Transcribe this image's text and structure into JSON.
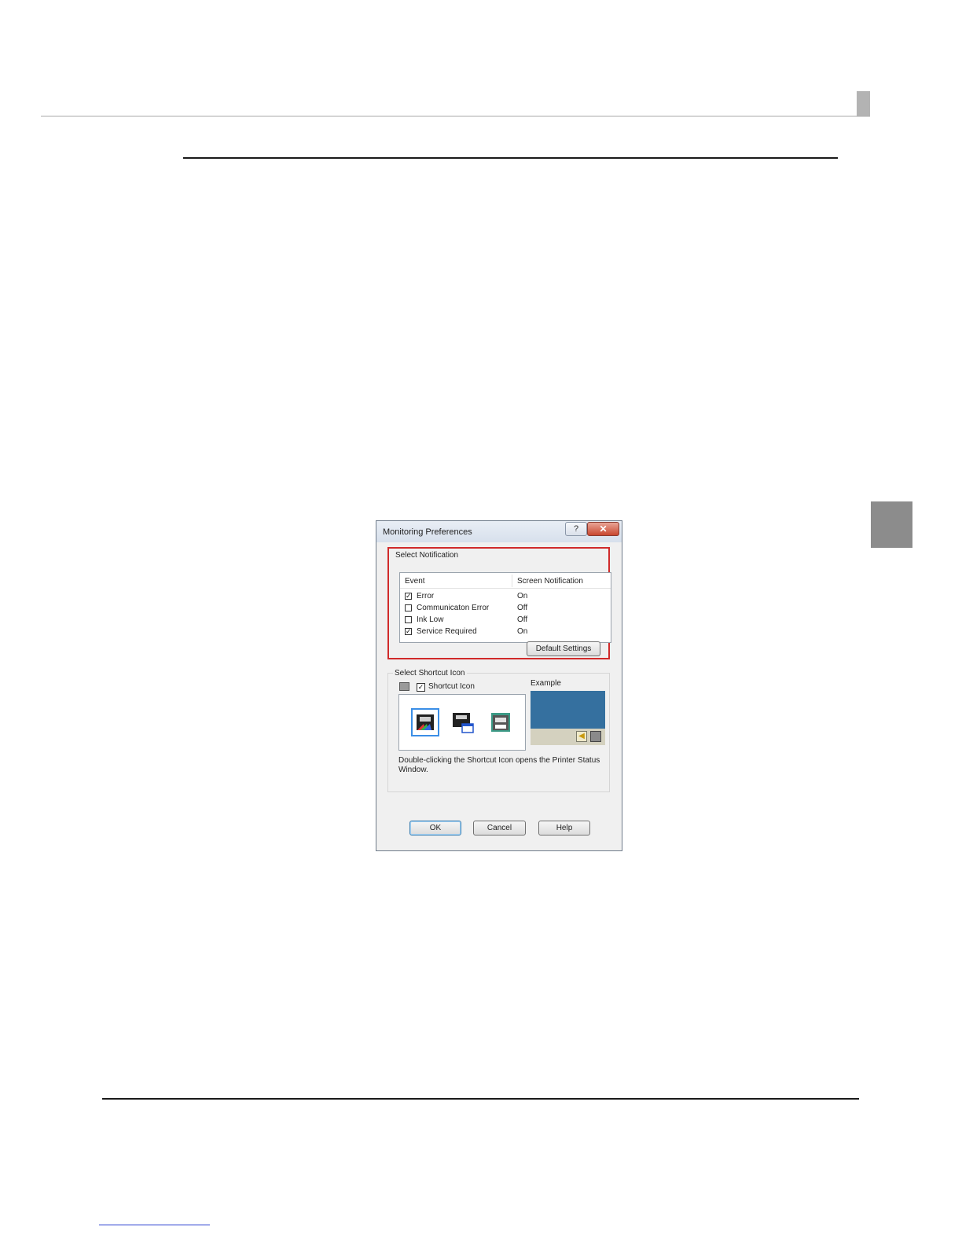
{
  "dialog": {
    "title": "Monitoring Preferences",
    "help_icon": "?",
    "close_icon": "✕",
    "select_notification": {
      "label": "Select Notification",
      "columns": [
        "Event",
        "Screen Notification"
      ],
      "rows": [
        {
          "event": "Error",
          "checked": true,
          "value": "On"
        },
        {
          "event": "Communicaton Error",
          "checked": false,
          "value": "Off"
        },
        {
          "event": "Ink Low",
          "checked": false,
          "value": "Off"
        },
        {
          "event": "Service Required",
          "checked": true,
          "value": "On"
        }
      ],
      "default_button": "Default Settings"
    },
    "select_shortcut": {
      "label": "Select Shortcut Icon",
      "shortcut_checkbox_label": "Shortcut Icon",
      "shortcut_checked": true,
      "example_label": "Example",
      "icons": [
        "printer-color-icon",
        "printer-monitor-icon",
        "printer-plain-icon"
      ],
      "description": "Double-clicking the Shortcut Icon opens the Printer Status Window."
    },
    "buttons": {
      "ok": "OK",
      "cancel": "Cancel",
      "help": "Help"
    }
  },
  "colors": {
    "highlight": "#d02a2a",
    "example_screen": "#35709f",
    "side_tab": "#8c8c8c"
  }
}
